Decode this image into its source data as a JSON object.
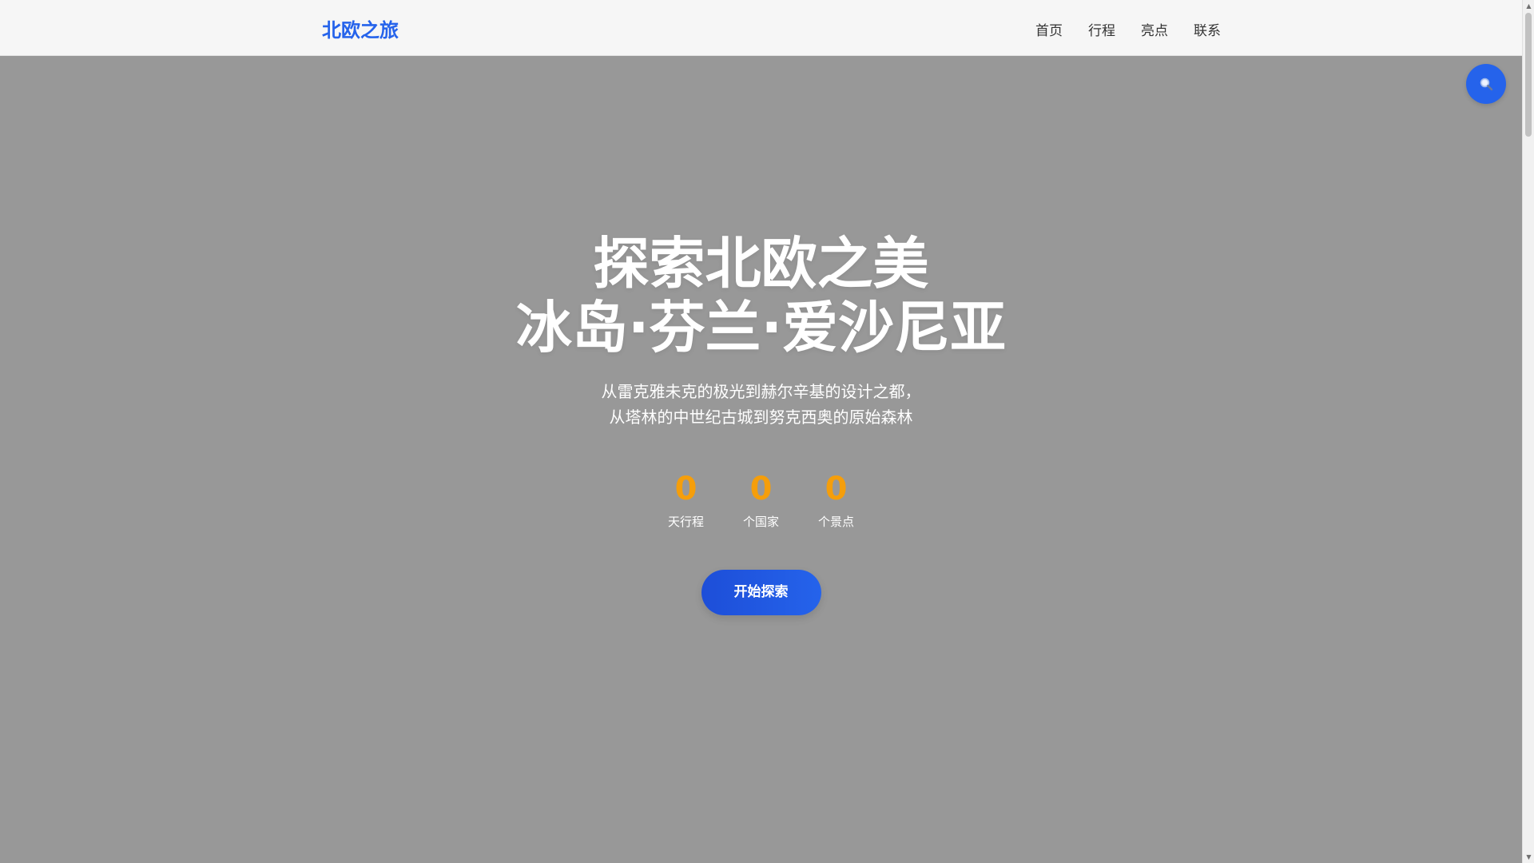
{
  "header": {
    "brand": "北欧之旅",
    "nav": [
      {
        "label": "首页"
      },
      {
        "label": "行程"
      },
      {
        "label": "亮点"
      },
      {
        "label": "联系"
      }
    ]
  },
  "search_button": {
    "icon": "search-icon"
  },
  "hero": {
    "title_line1": "探索北欧之美",
    "title_line2": "冰岛·芬兰·爱沙尼亚",
    "subtitle_line1": "从雷克雅未克的极光到赫尔辛基的设计之都，",
    "subtitle_line2": "从塔林的中世纪古城到努克西奥的原始森林",
    "stats": [
      {
        "value": "0",
        "label": "天行程"
      },
      {
        "value": "0",
        "label": "个国家"
      },
      {
        "value": "0",
        "label": "个景点"
      }
    ],
    "cta_label": "开始探索"
  },
  "colors": {
    "brand": "#2563eb",
    "accent": "#f59e0b",
    "overlay": "#989898",
    "header_bg": "#f6f6f6"
  }
}
